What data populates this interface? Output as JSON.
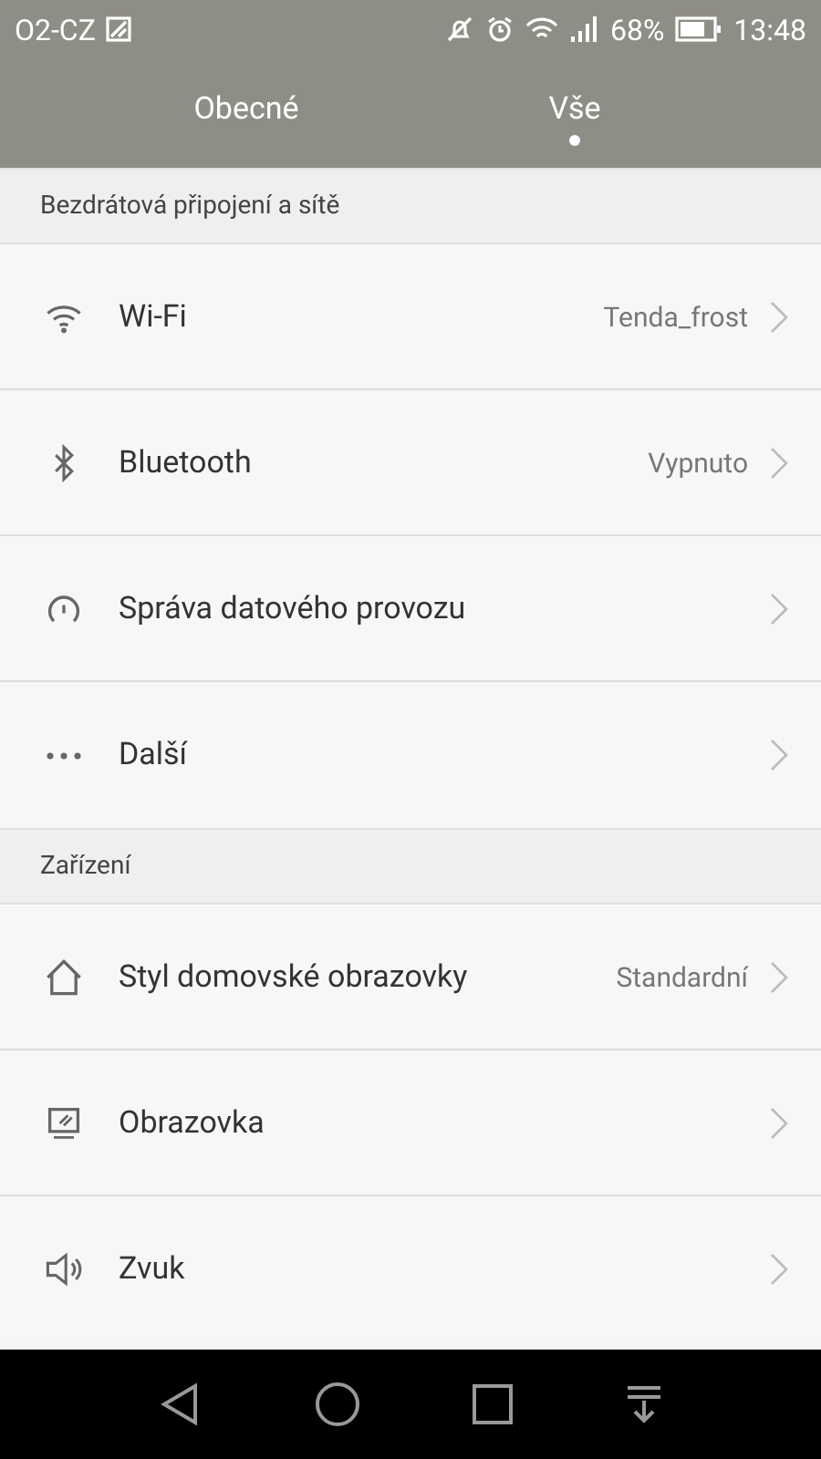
{
  "status_bar": {
    "carrier": "O2-CZ",
    "battery_percent": "68%",
    "time": "13:48"
  },
  "tabs": [
    {
      "label": "Obecné",
      "selected": false
    },
    {
      "label": "Vše",
      "selected": true
    }
  ],
  "sections": [
    {
      "title": "Bezdrátová připojení a sítě",
      "items": [
        {
          "kind": "wifi",
          "label": "Wi-Fi",
          "value": "Tenda_frost"
        },
        {
          "kind": "bluetooth",
          "label": "Bluetooth",
          "value": "Vypnuto"
        },
        {
          "kind": "gauge",
          "label": "Správa datového provozu"
        },
        {
          "kind": "more",
          "label": "Další"
        }
      ]
    },
    {
      "title": "Zařízení",
      "items": [
        {
          "kind": "home",
          "label": "Styl domovské obrazovky",
          "value": "Standardní"
        },
        {
          "kind": "display",
          "label": "Obrazovka"
        },
        {
          "kind": "sound",
          "label": "Zvuk"
        }
      ]
    }
  ]
}
